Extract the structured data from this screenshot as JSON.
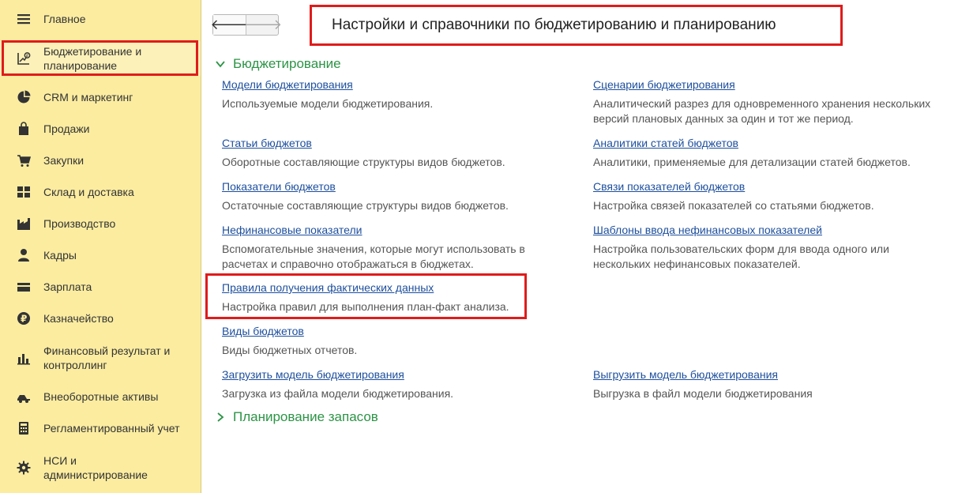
{
  "sidebar": {
    "items": [
      {
        "label": "Главное",
        "icon": "menu-icon"
      },
      {
        "label": "Бюджетирование и планирование",
        "icon": "budget-planning-icon"
      },
      {
        "label": "CRM и маркетинг",
        "icon": "pie-chart-icon"
      },
      {
        "label": "Продажи",
        "icon": "shopping-bag-icon"
      },
      {
        "label": "Закупки",
        "icon": "cart-icon"
      },
      {
        "label": "Склад и доставка",
        "icon": "warehouse-icon"
      },
      {
        "label": "Производство",
        "icon": "factory-icon"
      },
      {
        "label": "Кадры",
        "icon": "person-icon"
      },
      {
        "label": "Зарплата",
        "icon": "wallet-icon"
      },
      {
        "label": "Казначейство",
        "icon": "ruble-icon"
      },
      {
        "label": "Финансовый результат и контроллинг",
        "icon": "bar-chart-icon"
      },
      {
        "label": "Внеоборотные активы",
        "icon": "truck-icon"
      },
      {
        "label": "Регламентированный учет",
        "icon": "calculator-icon"
      },
      {
        "label": "НСИ и администрирование",
        "icon": "gear-icon"
      }
    ]
  },
  "nav": {
    "back": "🡐",
    "forward": "🡒"
  },
  "page": {
    "title": "Настройки и справочники по бюджетированию и планированию"
  },
  "sections": {
    "budgeting": "Бюджетирование",
    "stock_planning": "Планирование запасов"
  },
  "entries": {
    "budget_models": {
      "link": "Модели бюджетирования",
      "desc": "Используемые модели бюджетирования."
    },
    "budget_scenarios": {
      "link": "Сценарии бюджетирования",
      "desc": "Аналитический разрез для одновременного хранения нескольких версий плановых данных за один и тот же период."
    },
    "budget_items": {
      "link": "Статьи бюджетов",
      "desc": "Оборотные составляющие структуры видов бюджетов."
    },
    "budget_item_analytics": {
      "link": "Аналитики статей бюджетов",
      "desc": "Аналитики, применяемые для детализации статей бюджетов."
    },
    "budget_indicators": {
      "link": "Показатели бюджетов",
      "desc": "Остаточные составляющие структуры видов бюджетов."
    },
    "indicator_links": {
      "link": "Связи показателей бюджетов",
      "desc": "Настройка связей показателей со статьями бюджетов."
    },
    "nonfinancial": {
      "link": "Нефинансовые показатели",
      "desc": "Вспомогательные значения, которые могут использовать в расчетах и справочно отображаться в бюджетах."
    },
    "nonfinancial_templates": {
      "link": "Шаблоны ввода нефинансовых показателей",
      "desc": "Настройка пользовательских форм для ввода одного или нескольких нефинансовых показателей."
    },
    "actual_rules": {
      "link": "Правила получения фактических данных",
      "desc": "Настройка правил для выполнения план-факт анализа."
    },
    "budget_types": {
      "link": "Виды бюджетов",
      "desc": "Виды бюджетных отчетов."
    },
    "load_model": {
      "link": "Загрузить модель бюджетирования",
      "desc": "Загрузка из файла модели бюджетирования."
    },
    "export_model": {
      "link": "Выгрузить модель бюджетирования",
      "desc": "Выгрузка в файл модели бюджетирования"
    }
  },
  "colors": {
    "sidebar_bg": "#fbeca0",
    "link": "#1d4f9d",
    "section": "#2c9446",
    "highlight": "#e01b1b"
  }
}
